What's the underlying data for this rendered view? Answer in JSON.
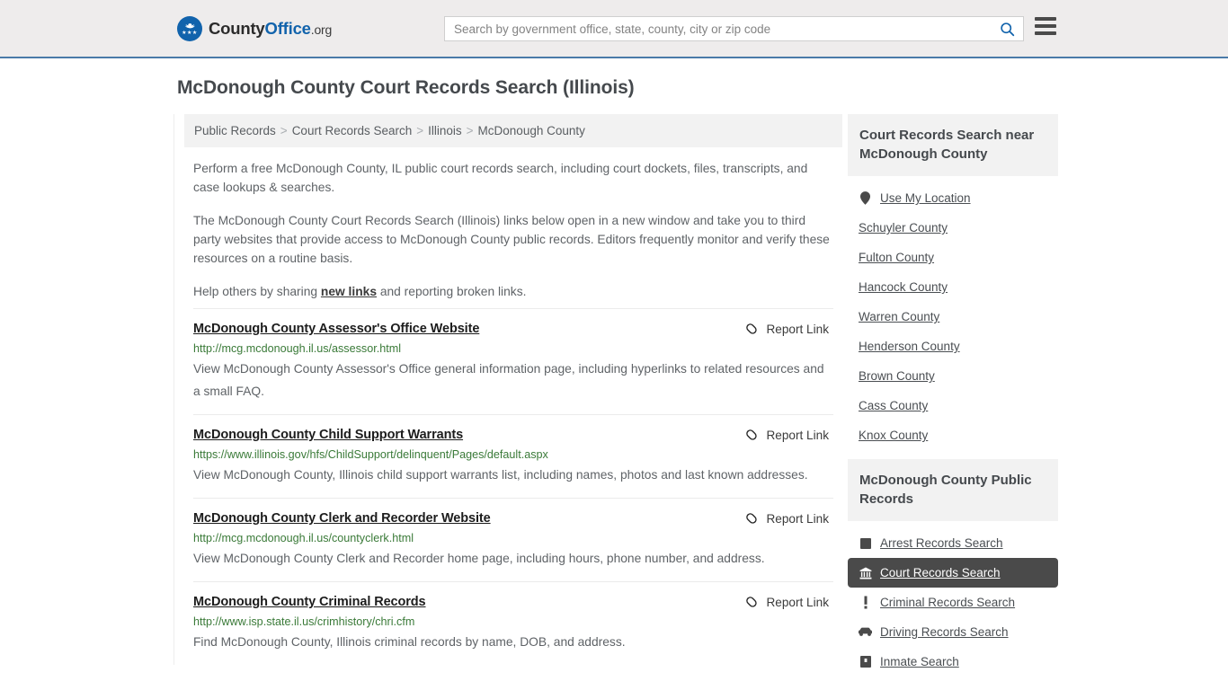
{
  "header": {
    "brand": {
      "part1": "County",
      "part2": "Office",
      "part3": ".org",
      "logo_icon": "eagle-shield-logo",
      "stars": "★★★"
    },
    "search": {
      "placeholder": "Search by government office, state, county, city or zip code",
      "value": "",
      "icon": "search-icon"
    },
    "menu_icon": "hamburger-menu-icon"
  },
  "page": {
    "title": "McDonough County Court Records Search (Illinois)"
  },
  "breadcrumb": {
    "separator": ">",
    "items": [
      {
        "label": "Public Records"
      },
      {
        "label": "Court Records Search"
      },
      {
        "label": "Illinois"
      },
      {
        "label": "McDonough County"
      }
    ]
  },
  "intro": {
    "p1": "Perform a free McDonough County, IL public court records search, including court dockets, files, transcripts, and case lookups & searches.",
    "p2": "The McDonough County Court Records Search (Illinois) links below open in a new window and take you to third party websites that provide access to McDonough County public records. Editors frequently monitor and verify these resources on a routine basis.",
    "p3_before": "Help others by sharing ",
    "p3_link": "new links",
    "p3_after": " and reporting broken links."
  },
  "results": {
    "report_label": "Report Link",
    "report_icon": "broken-link-icon",
    "items": [
      {
        "title": "McDonough County Assessor's Office Website",
        "url": "http://mcg.mcdonough.il.us/assessor.html",
        "description": "View McDonough County Assessor's Office general information page, including hyperlinks to related resources and a small FAQ."
      },
      {
        "title": "McDonough County Child Support Warrants",
        "url": "https://www.illinois.gov/hfs/ChildSupport/delinquent/Pages/default.aspx",
        "description": "View McDonough County, Illinois child support warrants list, including names, photos and last known addresses."
      },
      {
        "title": "McDonough County Clerk and Recorder Website",
        "url": "http://mcg.mcdonough.il.us/countyclerk.html",
        "description": "View McDonough County Clerk and Recorder home page, including hours, phone number, and address."
      },
      {
        "title": "McDonough County Criminal Records",
        "url": "http://www.isp.state.il.us/crimhistory/chri.cfm",
        "description": "Find McDonough County, Illinois criminal records by name, DOB, and address."
      }
    ]
  },
  "sidebar": {
    "nearby": {
      "heading": "Court Records Search near McDonough County",
      "items": [
        {
          "label": "Use My Location",
          "icon": "map-pin-icon",
          "has_icon": true
        },
        {
          "label": "Schuyler County",
          "icon": "",
          "has_icon": false
        },
        {
          "label": "Fulton County",
          "icon": "",
          "has_icon": false
        },
        {
          "label": "Hancock County",
          "icon": "",
          "has_icon": false
        },
        {
          "label": "Warren County",
          "icon": "",
          "has_icon": false
        },
        {
          "label": "Henderson County",
          "icon": "",
          "has_icon": false
        },
        {
          "label": "Brown County",
          "icon": "",
          "has_icon": false
        },
        {
          "label": "Cass County",
          "icon": "",
          "has_icon": false
        },
        {
          "label": "Knox County",
          "icon": "",
          "has_icon": false
        }
      ]
    },
    "public_records": {
      "heading": "McDonough County Public Records",
      "items": [
        {
          "label": "Arrest Records Search",
          "icon": "fingerprint-icon",
          "active": false
        },
        {
          "label": "Court Records Search",
          "icon": "courthouse-icon",
          "active": true
        },
        {
          "label": "Criminal Records Search",
          "icon": "exclamation-icon",
          "active": false
        },
        {
          "label": "Driving Records Search",
          "icon": "car-icon",
          "active": false
        },
        {
          "label": "Inmate Search",
          "icon": "jail-icon",
          "active": false
        }
      ]
    }
  },
  "colors": {
    "brand_blue": "#1163ac",
    "header_bg": "#eeecec",
    "header_border": "#4a7aa8",
    "url_green": "#3a7a38",
    "active_bg": "#4a4a4a",
    "panel_bg": "#f2f2f2"
  }
}
